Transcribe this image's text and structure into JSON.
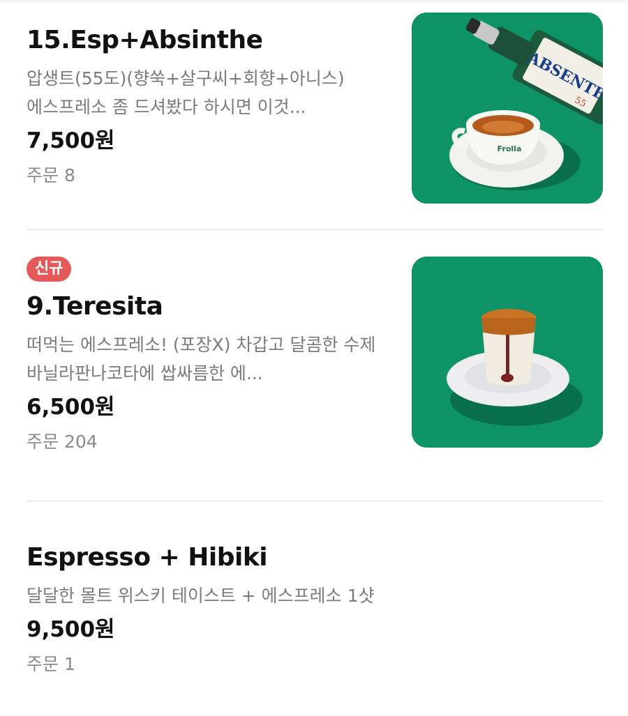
{
  "menu": {
    "items": [
      {
        "badge": "",
        "name": "15.Esp+Absinthe",
        "description": "압생트(55도)(향쑥+살구씨+회향+아니스) 에스프레소 좀 드셔봤다 하시면 이것...",
        "price": "7,500원",
        "orders": "주문 8",
        "bottle_label": "ABSENTE",
        "bottle_number": "55",
        "cup_label": "Frolla",
        "thumb_bg": "#0e9366"
      },
      {
        "badge": "신규",
        "name": "9.Teresita",
        "description": "떠먹는 에스프레소! (포장X) 차갑고 달콤한 수제 바닐라판나코타에 쌉싸름한 에...",
        "price": "6,500원",
        "orders": "주문 204",
        "thumb_bg": "#0e9366"
      },
      {
        "badge": "",
        "name": "Espresso + Hibiki",
        "description": "달달한 몰트 위스키 테이스트 + 에스프레소 1샷",
        "price": "9,500원",
        "orders": "주문 1"
      }
    ]
  },
  "colors": {
    "badge_bg": "#e45a5a",
    "thumb_green": "#0e9366",
    "divider": "#ededed"
  }
}
